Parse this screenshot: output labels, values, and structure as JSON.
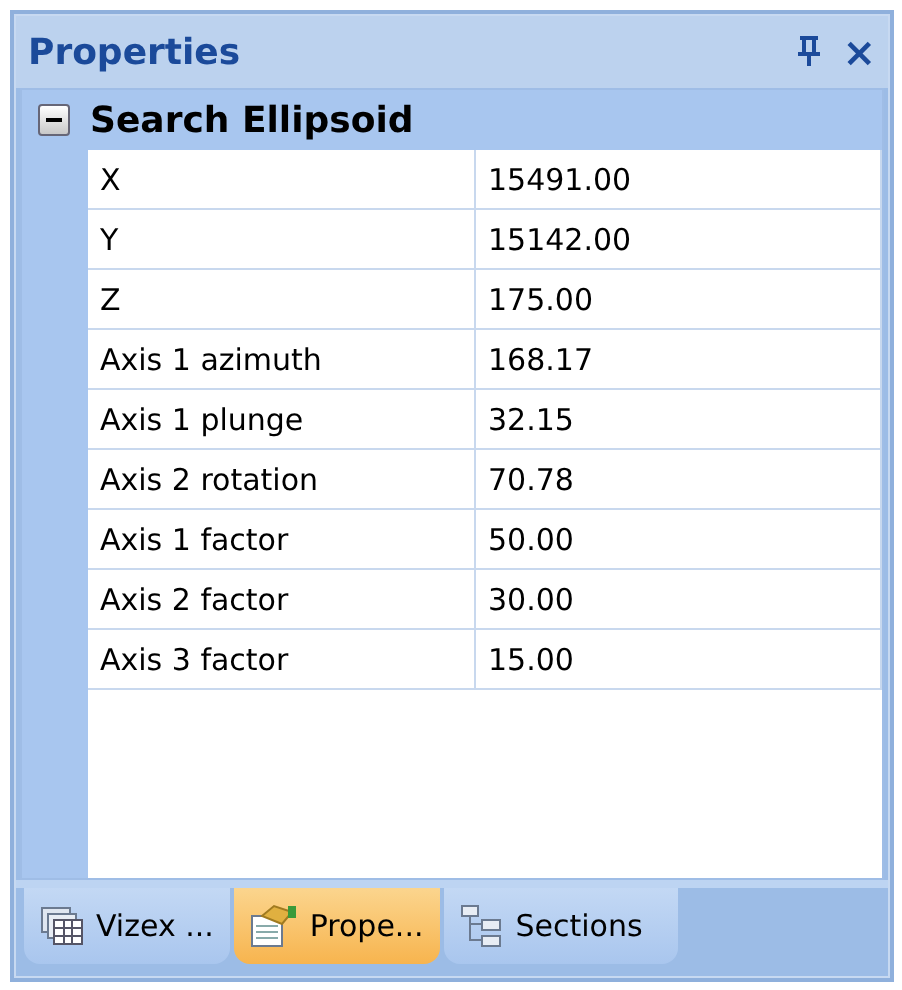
{
  "panel": {
    "title": "Properties",
    "close_icon": "×"
  },
  "group": {
    "label": "Search Ellipsoid",
    "expanded": true
  },
  "rows": [
    {
      "name": "X",
      "value": "15491.00"
    },
    {
      "name": "Y",
      "value": "15142.00"
    },
    {
      "name": "Z",
      "value": "175.00"
    },
    {
      "name": "Axis 1 azimuth",
      "value": "168.17"
    },
    {
      "name": "Axis 1 plunge",
      "value": "32.15"
    },
    {
      "name": "Axis 2 rotation",
      "value": "70.78"
    },
    {
      "name": "Axis 1 factor",
      "value": "50.00"
    },
    {
      "name": "Axis 2 factor",
      "value": "30.00"
    },
    {
      "name": "Axis 3 factor",
      "value": "15.00"
    }
  ],
  "tabs": [
    {
      "label": "Vizex ...",
      "kind": "grid",
      "selected": false
    },
    {
      "label": "Prope...",
      "kind": "props",
      "selected": true
    },
    {
      "label": "Sections",
      "kind": "tree",
      "selected": false
    }
  ]
}
